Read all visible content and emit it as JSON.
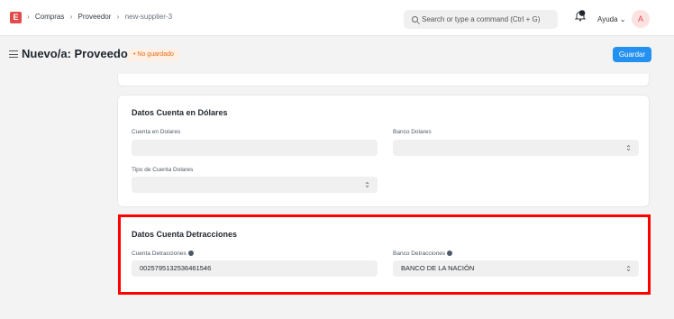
{
  "navbar": {
    "logo_letter": "E",
    "breadcrumbs": [
      "Compras",
      "Proveedor",
      "new-supplier-3"
    ],
    "search_placeholder": "Search or type a command (Ctrl + G)",
    "help_label": "Ayuda",
    "avatar_initial": "A"
  },
  "page": {
    "title": "Nuevo/a: Proveedor",
    "status_badge": "No guardado",
    "save_label": "Guardar"
  },
  "sections": {
    "usd": {
      "title": "Datos Cuenta en Dólares",
      "cuenta_label": "Cuenta en Dolares",
      "cuenta_value": "",
      "banco_label": "Banco Dolares",
      "banco_value": "",
      "tipo_label": "Tipo de Cuenta Dolares",
      "tipo_value": ""
    },
    "detracciones": {
      "title": "Datos Cuenta Detracciones",
      "cuenta_label": "Cuenta Detracciones",
      "cuenta_value": "0025795132536461546",
      "banco_label": "Banco Detracciones",
      "banco_value": "BANCO DE LA NACIÓN"
    }
  },
  "colors": {
    "primary": "#2490ef",
    "logo": "#e24c4b",
    "highlight": "#ff0000",
    "badge_text": "#e86c13"
  }
}
